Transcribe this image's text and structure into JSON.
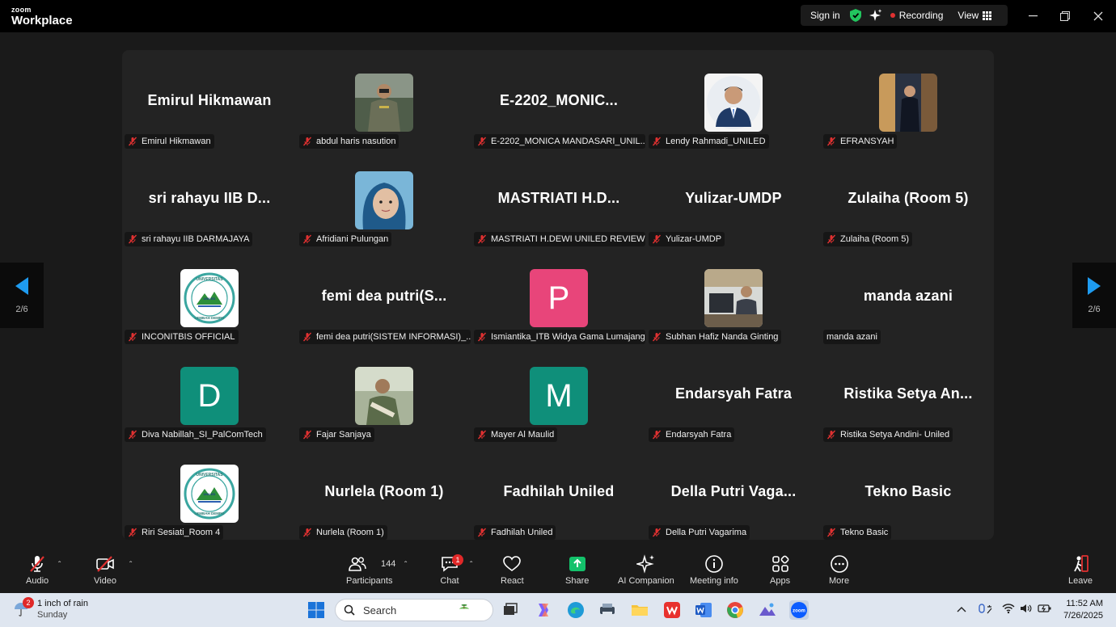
{
  "app": {
    "logo_small": "zoom",
    "logo_big": "Workplace"
  },
  "titlebar": {
    "sign_in": "Sign in",
    "recording": "Recording",
    "view": "View"
  },
  "pager": {
    "left": "2/6",
    "right": "2/6"
  },
  "participants": [
    {
      "display": "Emirul Hikmawan",
      "label": "Emirul Hikmawan",
      "kind": "text",
      "muted": true
    },
    {
      "display": "",
      "label": "abdul haris nasution",
      "kind": "photo",
      "photo": "officer",
      "muted": true
    },
    {
      "display": "E-2202_MONIC...",
      "label": "E-2202_MONICA MANDASARI_UNIL...",
      "kind": "text",
      "muted": true
    },
    {
      "display": "",
      "label": "Lendy Rahmadi_UNILED",
      "kind": "photo",
      "photo": "portrait",
      "muted": true
    },
    {
      "display": "",
      "label": "EFRANSYAH",
      "kind": "photo",
      "photo": "suit",
      "muted": true
    },
    {
      "display": "sri rahayu IIB D...",
      "label": "sri rahayu IIB DARMAJAYA",
      "kind": "text",
      "muted": true
    },
    {
      "display": "",
      "label": "Afridiani Pulungan",
      "kind": "photo",
      "photo": "hijab",
      "muted": true
    },
    {
      "display": "MASTRIATI  H.D...",
      "label": "MASTRIATI H.DEWI UNILED REVIEW",
      "kind": "text",
      "muted": true
    },
    {
      "display": "Yulizar-UMDP",
      "label": "Yulizar-UMDP",
      "kind": "text",
      "muted": true
    },
    {
      "display": "Zulaiha (Room 5)",
      "label": "Zulaiha (Room 5)",
      "kind": "text",
      "muted": true
    },
    {
      "display": "",
      "label": "INCONITBIS OFFICIAL",
      "kind": "photo",
      "photo": "logo",
      "muted": true
    },
    {
      "display": "femi  dea  putri(S...",
      "label": "femi dea putri(SISTEM INFORMASI)_...",
      "kind": "text",
      "muted": true
    },
    {
      "display": "P",
      "label": "Ismiantika_ITB Widya Gama Lumajang",
      "kind": "letter",
      "color": "#e8457a",
      "muted": true
    },
    {
      "display": "",
      "label": "Subhan Hafiz Nanda Ginting",
      "kind": "photo",
      "photo": "desk",
      "muted": true
    },
    {
      "display": "manda azani",
      "label": "manda azani",
      "kind": "text",
      "muted": false
    },
    {
      "display": "D",
      "label": "Diva Nabillah_SI_PalComTech",
      "kind": "letter",
      "color": "#0f8f7a",
      "muted": true
    },
    {
      "display": "",
      "label": "Fajar Sanjaya",
      "kind": "photo",
      "photo": "outdoor",
      "muted": true
    },
    {
      "display": "M",
      "label": "Mayer Al Maulid",
      "kind": "letter",
      "color": "#0f8f7a",
      "muted": true
    },
    {
      "display": "Endarsyah Fatra",
      "label": "Endarsyah Fatra",
      "kind": "text",
      "muted": true
    },
    {
      "display": "Ristika Setya An...",
      "label": "Ristika Setya Andini- Uniled",
      "kind": "text",
      "muted": true
    },
    {
      "display": "",
      "label": "Riri Sesiati_Room 4",
      "kind": "photo",
      "photo": "logo",
      "muted": true
    },
    {
      "display": "Nurlela (Room 1)",
      "label": "Nurlela (Room 1)",
      "kind": "text",
      "muted": true
    },
    {
      "display": "Fadhilah Uniled",
      "label": "Fadhilah Uniled",
      "kind": "text",
      "muted": true
    },
    {
      "display": "Della Putri Vaga...",
      "label": "Della Putri Vagarima",
      "kind": "text",
      "muted": true
    },
    {
      "display": "Tekno Basic",
      "label": "Tekno Basic",
      "kind": "text",
      "muted": true
    }
  ],
  "toolbar": {
    "audio": "Audio",
    "video": "Video",
    "participants": "Participants",
    "participants_count": "144",
    "chat": "Chat",
    "chat_badge": "1",
    "react": "React",
    "share": "Share",
    "ai": "AI Companion",
    "info": "Meeting info",
    "apps": "Apps",
    "more": "More",
    "leave": "Leave"
  },
  "taskbar": {
    "weather_badge": "2",
    "weather_line1": "1 inch of rain",
    "weather_line2": "Sunday",
    "search": "Search",
    "time": "11:52 AM",
    "date": "7/26/2025"
  },
  "colors": {
    "share": "#13c26b",
    "accent": "#0e72ed",
    "muted_red": "#e03131"
  }
}
